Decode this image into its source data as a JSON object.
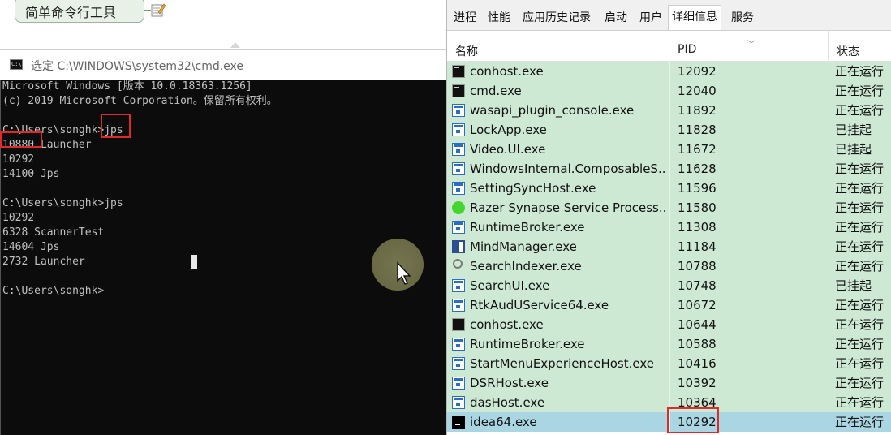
{
  "mindmap": {
    "node_label": "简单命令行工具"
  },
  "cmd": {
    "title": "选定 C:\\WINDOWS\\system32\\cmd.exe",
    "lines": [
      "Microsoft Windows [版本 10.0.18363.1256]",
      "(c) 2019 Microsoft Corporation。保留所有权利。",
      "",
      "C:\\Users\\songhk>jps",
      "10880 Launcher",
      "10292",
      "14100 Jps",
      "",
      "C:\\Users\\songhk>jps",
      "10292",
      "6328 ScannerTest",
      "14604 Jps",
      "2732 Launcher",
      "",
      "C:\\Users\\songhk>"
    ]
  },
  "taskmgr": {
    "tabs": [
      "进程",
      "性能",
      "应用历史记录",
      "启动",
      "用户",
      "详细信息",
      "服务"
    ],
    "active_tab": "详细信息",
    "columns": {
      "name": "名称",
      "pid": "PID",
      "status": "状态"
    },
    "rows": [
      {
        "icon": "console-icon",
        "name": "conhost.exe",
        "pid": "12092",
        "status": "正在运行"
      },
      {
        "icon": "console-icon",
        "name": "cmd.exe",
        "pid": "12040",
        "status": "正在运行"
      },
      {
        "icon": "app-window-icon",
        "name": "wasapi_plugin_console.exe",
        "pid": "11892",
        "status": "正在运行"
      },
      {
        "icon": "app-window-icon",
        "name": "LockApp.exe",
        "pid": "11828",
        "status": "已挂起"
      },
      {
        "icon": "app-window-icon",
        "name": "Video.UI.exe",
        "pid": "11672",
        "status": "已挂起"
      },
      {
        "icon": "app-window-icon",
        "name": "WindowsInternal.ComposableS...",
        "pid": "11628",
        "status": "正在运行"
      },
      {
        "icon": "app-window-icon",
        "name": "SettingSyncHost.exe",
        "pid": "11596",
        "status": "正在运行"
      },
      {
        "icon": "razer-icon",
        "name": "Razer Synapse Service Process....",
        "pid": "11580",
        "status": "正在运行"
      },
      {
        "icon": "app-window-icon",
        "name": "RuntimeBroker.exe",
        "pid": "11308",
        "status": "正在运行"
      },
      {
        "icon": "mindmanager-icon",
        "name": "MindManager.exe",
        "pid": "11184",
        "status": "正在运行"
      },
      {
        "icon": "search-icon",
        "name": "SearchIndexer.exe",
        "pid": "10788",
        "status": "正在运行"
      },
      {
        "icon": "app-window-icon",
        "name": "SearchUI.exe",
        "pid": "10748",
        "status": "已挂起"
      },
      {
        "icon": "app-window-icon",
        "name": "RtkAudUService64.exe",
        "pid": "10672",
        "status": "正在运行"
      },
      {
        "icon": "console-icon",
        "name": "conhost.exe",
        "pid": "10644",
        "status": "正在运行"
      },
      {
        "icon": "app-window-icon",
        "name": "RuntimeBroker.exe",
        "pid": "10588",
        "status": "正在运行"
      },
      {
        "icon": "app-window-icon",
        "name": "StartMenuExperienceHost.exe",
        "pid": "10416",
        "status": "正在运行"
      },
      {
        "icon": "app-window-icon",
        "name": "DSRHost.exe",
        "pid": "10392",
        "status": "正在运行"
      },
      {
        "icon": "app-window-icon",
        "name": "dasHost.exe",
        "pid": "10364",
        "status": "正在运行"
      },
      {
        "icon": "intellij-idea-icon",
        "name": "idea64.exe",
        "pid": "10292",
        "status": "正在运行"
      }
    ]
  }
}
